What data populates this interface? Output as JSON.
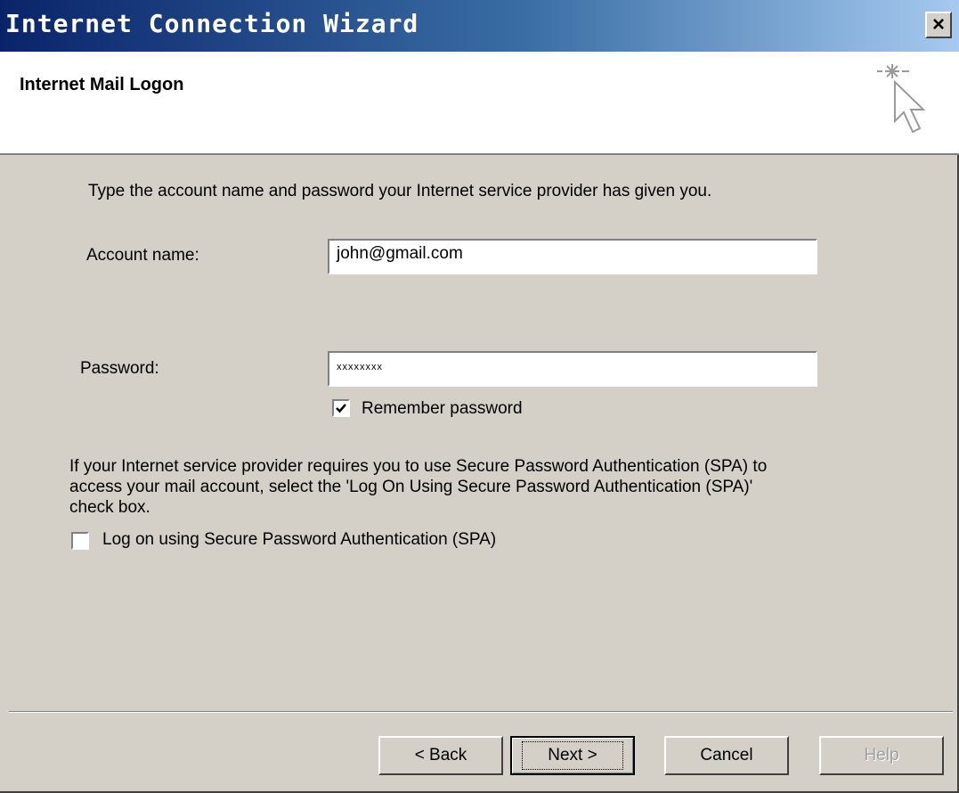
{
  "window": {
    "title": "Internet Connection Wizard",
    "close_label": "×"
  },
  "header": {
    "title": "Internet Mail Logon",
    "icon": "wizard-cursor-sparkle-icon"
  },
  "form": {
    "instruction": "Type the account name and password your Internet service provider has given you.",
    "account_label": "Account name:",
    "account_value": "john@gmail.com",
    "password_label": "Password:",
    "password_value": "xxxxxxxx",
    "remember_label": "Remember password",
    "remember_checked": true,
    "spa_text": "If your Internet service provider requires you to use Secure Password Authentication (SPA) to access your mail account, select the 'Log On Using Secure Password Authentication (SPA)' check box.",
    "spa_label": "Log on using Secure Password Authentication (SPA)",
    "spa_checked": false
  },
  "buttons": {
    "back": "< Back",
    "next": "Next >",
    "cancel": "Cancel",
    "help": "Help"
  },
  "colors": {
    "title_start": "#0a246a",
    "title_end": "#a6caf0",
    "face": "#d4d0c8"
  }
}
